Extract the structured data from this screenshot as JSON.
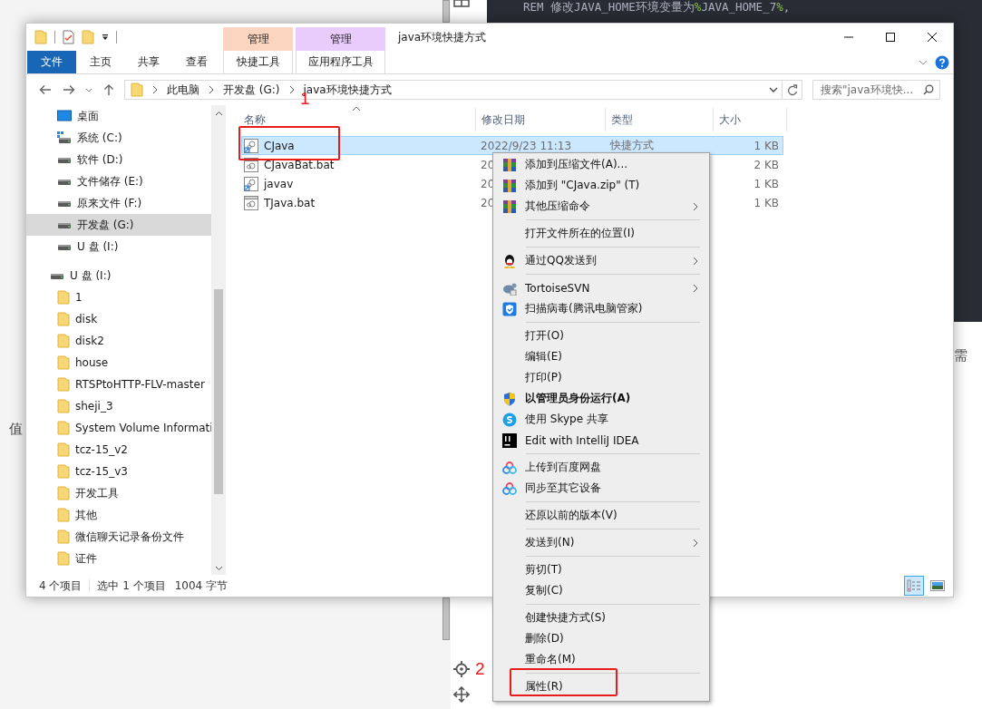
{
  "background": {
    "editor_line": [
      {
        "text": "REM 修改JAVA_HOME环境变量为",
        "kind": "plain"
      },
      {
        "text": "%",
        "kind": "symbol"
      },
      {
        "text": "JAVA_HOME_7",
        "kind": "plain"
      },
      {
        "text": "%",
        "kind": "symbol"
      },
      {
        "text": ",",
        "kind": "plain"
      }
    ],
    "left_fragment": "值",
    "right_fragment": "需"
  },
  "window": {
    "title": "java环境快捷方式",
    "ribbon_tabs": [
      {
        "label": "文件",
        "kind": "file",
        "selected": false
      },
      {
        "label": "主页",
        "kind": "plain",
        "selected": false
      },
      {
        "label": "共享",
        "kind": "plain",
        "selected": false
      },
      {
        "label": "查看",
        "kind": "plain",
        "selected": false
      }
    ],
    "context_groups": [
      {
        "label": "管理",
        "color": "#fcd5c1",
        "tab": {
          "label": "快捷工具",
          "selected": false
        }
      },
      {
        "label": "管理",
        "color": "#e9ccfb",
        "tab": {
          "label": "应用程序工具",
          "selected": false
        }
      }
    ],
    "address": {
      "crumbs": [
        "此电脑",
        "开发盘 (G:)",
        "java环境快捷方式"
      ]
    },
    "search": {
      "placeholder": "搜索\"java环境快..."
    },
    "nav": {
      "drives": [
        {
          "label": "桌面",
          "kind": "desktop",
          "selected": false
        },
        {
          "label": "系统 (C:)",
          "kind": "system",
          "selected": false
        },
        {
          "label": "软件 (D:)",
          "kind": "drive",
          "selected": false
        },
        {
          "label": "文件储存 (E:)",
          "kind": "drive",
          "selected": false
        },
        {
          "label": "原来文件 (F:)",
          "kind": "drive",
          "selected": false
        },
        {
          "label": "开发盘 (G:)",
          "kind": "drive",
          "selected": true
        },
        {
          "label": "U 盘 (I:)",
          "kind": "drive",
          "selected": false
        }
      ],
      "usb": {
        "label": "U 盘 (I:)",
        "kind": "drive",
        "selected": false,
        "children": [
          {
            "label": "1",
            "selected": false
          },
          {
            "label": "disk",
            "selected": false
          },
          {
            "label": "disk2",
            "selected": false
          },
          {
            "label": "house",
            "selected": false
          },
          {
            "label": "RTSPtoHTTP-FLV-master",
            "selected": false
          },
          {
            "label": "sheji_3",
            "selected": false
          },
          {
            "label": "System Volume Informati",
            "selected": false
          },
          {
            "label": "tcz-15_v2",
            "selected": false
          },
          {
            "label": "tcz-15_v3",
            "selected": false
          },
          {
            "label": "开发工具",
            "selected": false
          },
          {
            "label": "其他",
            "selected": false
          },
          {
            "label": "微信聊天记录备份文件",
            "selected": false
          },
          {
            "label": "证件",
            "selected": false
          }
        ]
      }
    },
    "files": {
      "columns": [
        "名称",
        "修改日期",
        "类型",
        "大小"
      ],
      "rows": [
        {
          "name": "CJava",
          "kind": "shortcut",
          "date": "2022/9/23 11:13",
          "type": "快捷方式",
          "size": "1 KB",
          "selected": true
        },
        {
          "name": "CJavaBat.bat",
          "kind": "batch",
          "date": "20",
          "size": "2 KB",
          "selected": false
        },
        {
          "name": "javav",
          "kind": "shortcut",
          "date": "20",
          "size": "1 KB",
          "selected": false
        },
        {
          "name": "TJava.bat",
          "kind": "batch",
          "date": "20",
          "size": "1 KB",
          "selected": false
        }
      ]
    },
    "status": {
      "count": "4 个项目",
      "selection": "选中 1 个项目",
      "size": "1004 字节"
    },
    "view_buttons": [
      {
        "kind": "details",
        "selected": true
      },
      {
        "kind": "large_icons",
        "selected": false
      }
    ]
  },
  "menu": {
    "items": [
      {
        "kind": "archive",
        "label": "添加到压缩文件(A)...",
        "submenu": false,
        "bold": false
      },
      {
        "kind": "archive",
        "label": "添加到 \"CJava.zip\" (T)",
        "submenu": false,
        "bold": false
      },
      {
        "kind": "archive",
        "label": "其他压缩命令",
        "submenu": true,
        "bold": false
      },
      {
        "kind": "separator"
      },
      {
        "kind": "plain",
        "label": "打开文件所在的位置(I)",
        "submenu": false,
        "bold": false
      },
      {
        "kind": "separator"
      },
      {
        "kind": "penguin",
        "label": "通过QQ发送到",
        "submenu": true,
        "bold": false
      },
      {
        "kind": "separator"
      },
      {
        "kind": "turtle",
        "label": "TortoiseSVN",
        "submenu": true,
        "bold": false
      },
      {
        "kind": "shield",
        "label": "扫描病毒(腾讯电脑管家)",
        "submenu": false,
        "bold": false
      },
      {
        "kind": "separator"
      },
      {
        "kind": "plain",
        "label": "打开(O)",
        "submenu": false,
        "bold": false
      },
      {
        "kind": "plain",
        "label": "编辑(E)",
        "submenu": false,
        "bold": false
      },
      {
        "kind": "plain",
        "label": "打印(P)",
        "submenu": false,
        "bold": false
      },
      {
        "kind": "uac",
        "label": "以管理员身份运行(A)",
        "submenu": false,
        "bold": true
      },
      {
        "kind": "skype",
        "label": "使用 Skype 共享",
        "submenu": false,
        "bold": false
      },
      {
        "kind": "ide",
        "label": "Edit with IntelliJ IDEA",
        "submenu": false,
        "bold": false
      },
      {
        "kind": "separator"
      },
      {
        "kind": "cloud",
        "label": "上传到百度网盘",
        "submenu": false,
        "bold": false
      },
      {
        "kind": "cloud",
        "label": "同步至其它设备",
        "submenu": false,
        "bold": false
      },
      {
        "kind": "separator"
      },
      {
        "kind": "plain",
        "label": "还原以前的版本(V)",
        "submenu": false,
        "bold": false
      },
      {
        "kind": "separator"
      },
      {
        "kind": "plain",
        "label": "发送到(N)",
        "submenu": true,
        "bold": false
      },
      {
        "kind": "separator"
      },
      {
        "kind": "plain",
        "label": "剪切(T)",
        "submenu": false,
        "bold": false
      },
      {
        "kind": "plain",
        "label": "复制(C)",
        "submenu": false,
        "bold": false
      },
      {
        "kind": "separator"
      },
      {
        "kind": "plain",
        "label": "创建快捷方式(S)",
        "submenu": false,
        "bold": false
      },
      {
        "kind": "plain",
        "label": "删除(D)",
        "submenu": false,
        "bold": false
      },
      {
        "kind": "plain",
        "label": "重命名(M)",
        "submenu": false,
        "bold": false
      },
      {
        "kind": "separator"
      },
      {
        "kind": "plain",
        "label": "属性(R)",
        "submenu": false,
        "bold": false
      }
    ]
  },
  "annotations": [
    {
      "label": "1"
    },
    {
      "label": "2"
    }
  ]
}
